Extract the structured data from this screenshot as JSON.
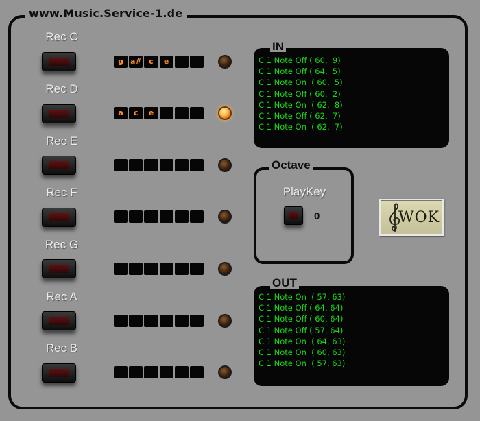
{
  "site_title": "www.Music.Service-1.de",
  "rows": [
    {
      "label": "Rec C",
      "notes": [
        "g",
        "a#",
        "c",
        "e",
        "",
        ""
      ],
      "led": "off"
    },
    {
      "label": "Rec D",
      "notes": [
        "a",
        "c",
        "e",
        "",
        "",
        ""
      ],
      "led": "on"
    },
    {
      "label": "Rec E",
      "notes": [
        "",
        "",
        "",
        "",
        "",
        ""
      ],
      "led": "off"
    },
    {
      "label": "Rec F",
      "notes": [
        "",
        "",
        "",
        "",
        "",
        ""
      ],
      "led": "off"
    },
    {
      "label": "Rec G",
      "notes": [
        "",
        "",
        "",
        "",
        "",
        ""
      ],
      "led": "off"
    },
    {
      "label": "Rec A",
      "notes": [
        "",
        "",
        "",
        "",
        "",
        ""
      ],
      "led": "off"
    },
    {
      "label": "Rec B",
      "notes": [
        "",
        "",
        "",
        "",
        "",
        ""
      ],
      "led": "off"
    }
  ],
  "in_monitor": {
    "title": "IN",
    "lines": [
      "C 1 Note Off ( 60,  9)",
      "C 1 Note Off ( 64,  5)",
      "C 1 Note On  ( 60,  5)",
      "C 1 Note Off ( 60,  2)",
      "C 1 Note On  ( 62,  8)",
      "C 1 Note Off ( 62,  7)",
      "C 1 Note On  ( 62,  7)"
    ]
  },
  "octave": {
    "title": "Octave",
    "playkey_label": "PlayKey",
    "value": "0"
  },
  "logo": {
    "text": "WOK",
    "icon": "treble-clef-icon"
  },
  "out_monitor": {
    "title": "OUT",
    "lines": [
      "C 1 Note On  ( 57, 63)",
      "C 1 Note Off ( 64, 64)",
      "C 1 Note Off ( 60, 64)",
      "C 1 Note Off ( 57, 64)",
      "C 1 Note On  ( 64, 63)",
      "C 1 Note On  ( 60, 63)",
      "C 1 Note On  ( 57, 63)"
    ]
  },
  "colors": {
    "panel": "#959595",
    "note_text": "#ff8c2a",
    "log_text": "#18d818",
    "led_on": "#ffae3a"
  }
}
